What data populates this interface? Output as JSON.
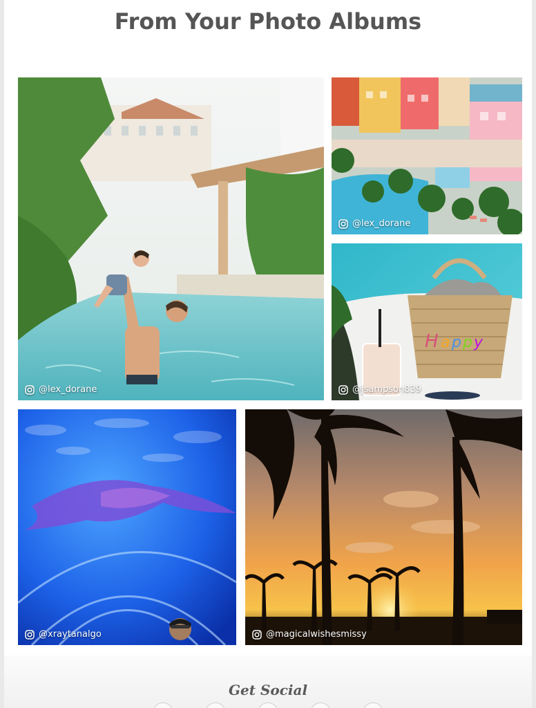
{
  "section": {
    "title": "From Your Photo Albums"
  },
  "photos": [
    {
      "handle": "@lex_dorane",
      "icon": "instagram-icon"
    },
    {
      "handle": "@lex_dorane",
      "icon": "instagram-icon"
    },
    {
      "handle": "@jsampson839",
      "icon": "instagram-icon"
    },
    {
      "handle": "@xraytanalgo",
      "icon": "instagram-icon"
    },
    {
      "handle": "@magicalwishesmissy",
      "icon": "instagram-icon"
    }
  ],
  "footer": {
    "heading": "Get Social"
  },
  "colors": {
    "title": "#555555",
    "panel": "#ffffff",
    "page_bg": "#e9e9e9"
  }
}
